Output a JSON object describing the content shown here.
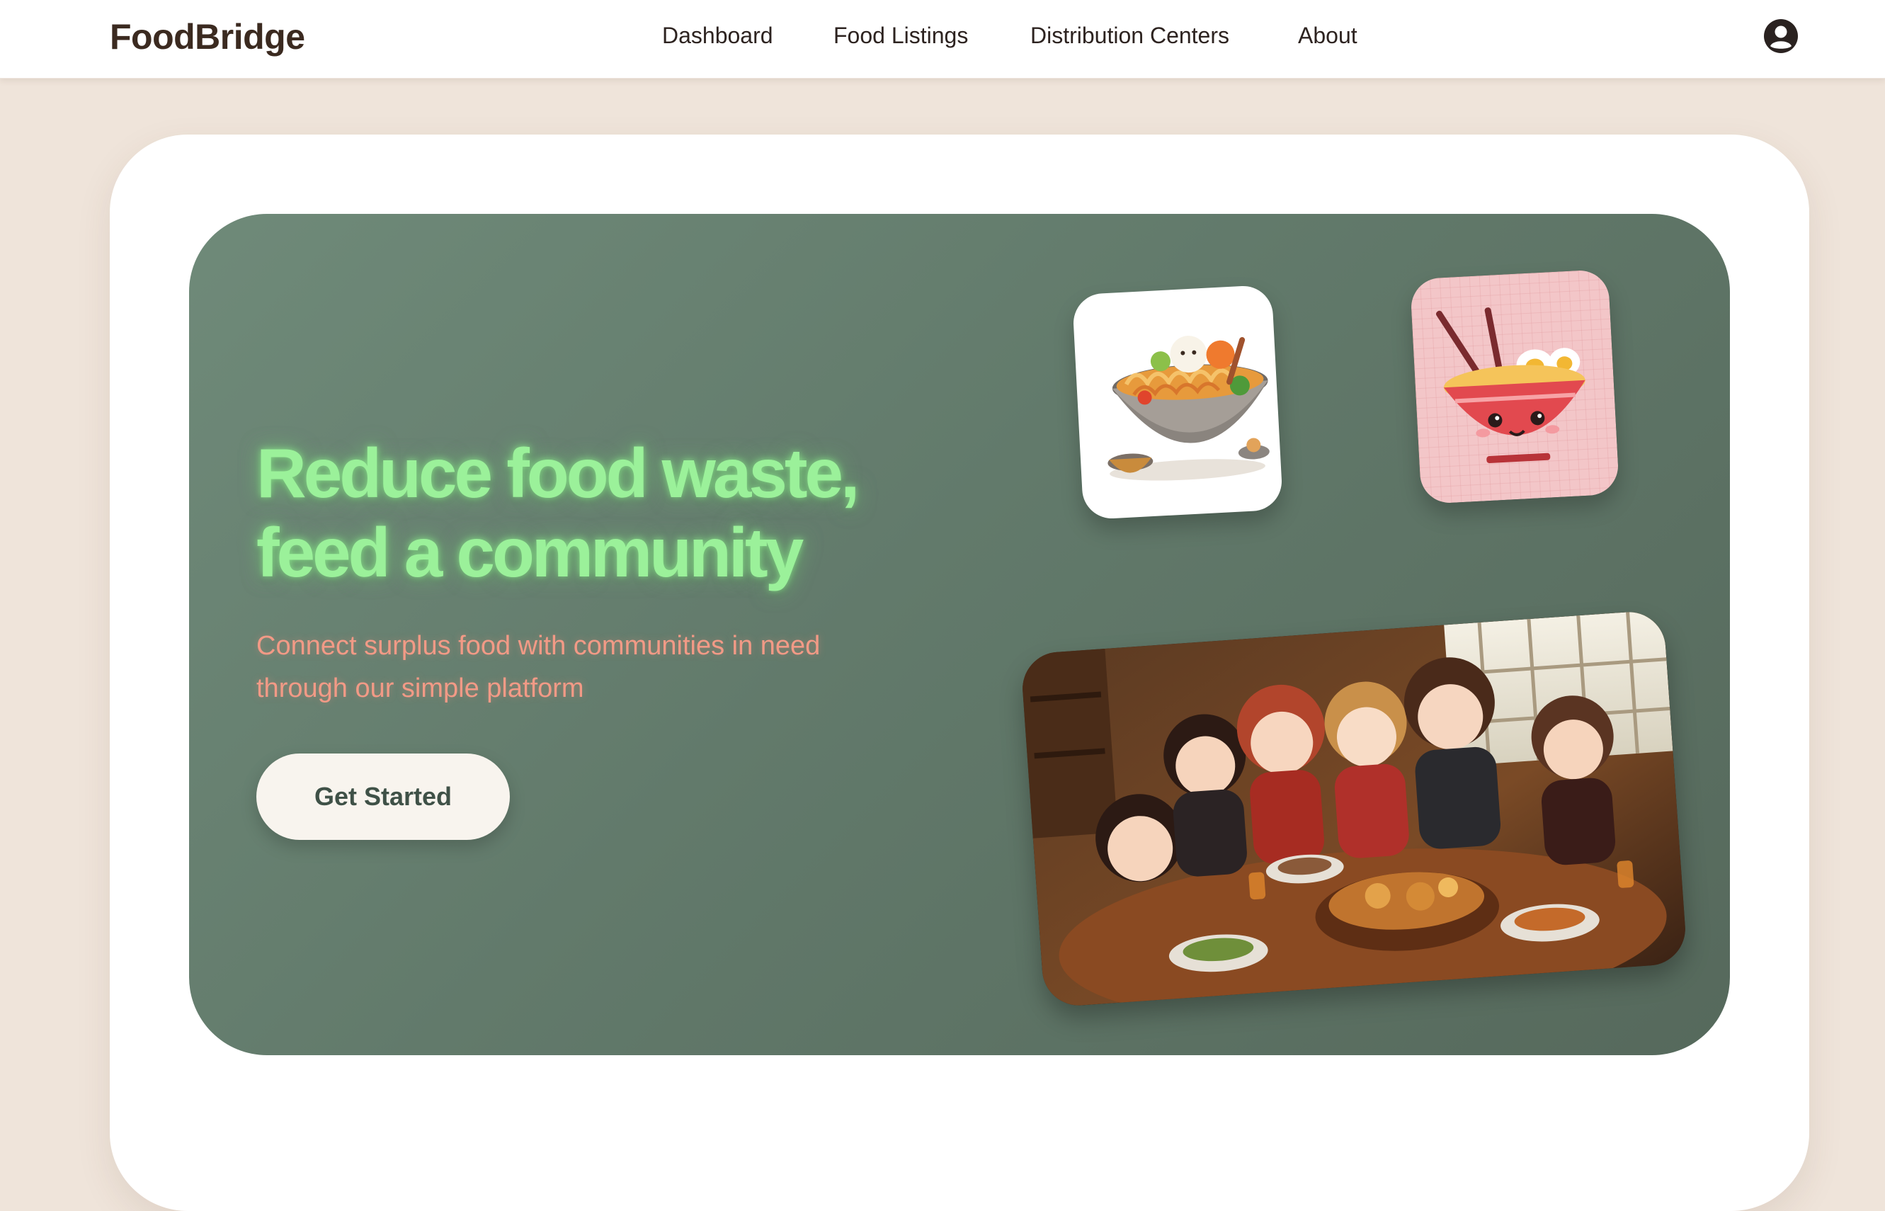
{
  "header": {
    "brand": "FoodBridge",
    "nav": [
      "Dashboard",
      "Food Listings",
      "Distribution Centers",
      "About"
    ],
    "account_icon": "user-circle-icon"
  },
  "hero": {
    "title_line1": "Reduce food waste,",
    "title_line2": "feed a community",
    "subtitle_line1": "Connect surplus food with communities in need",
    "subtitle_line2": "through our simple platform",
    "cta_label": "Get Started"
  },
  "colors": {
    "page_bg": "#efe4da",
    "brand_text": "#3b2a20",
    "hero_green": "#627a6b",
    "headline_green": "#9bf19a",
    "subtitle_salmon": "#f29a86",
    "button_bg": "#f8f4ee"
  }
}
